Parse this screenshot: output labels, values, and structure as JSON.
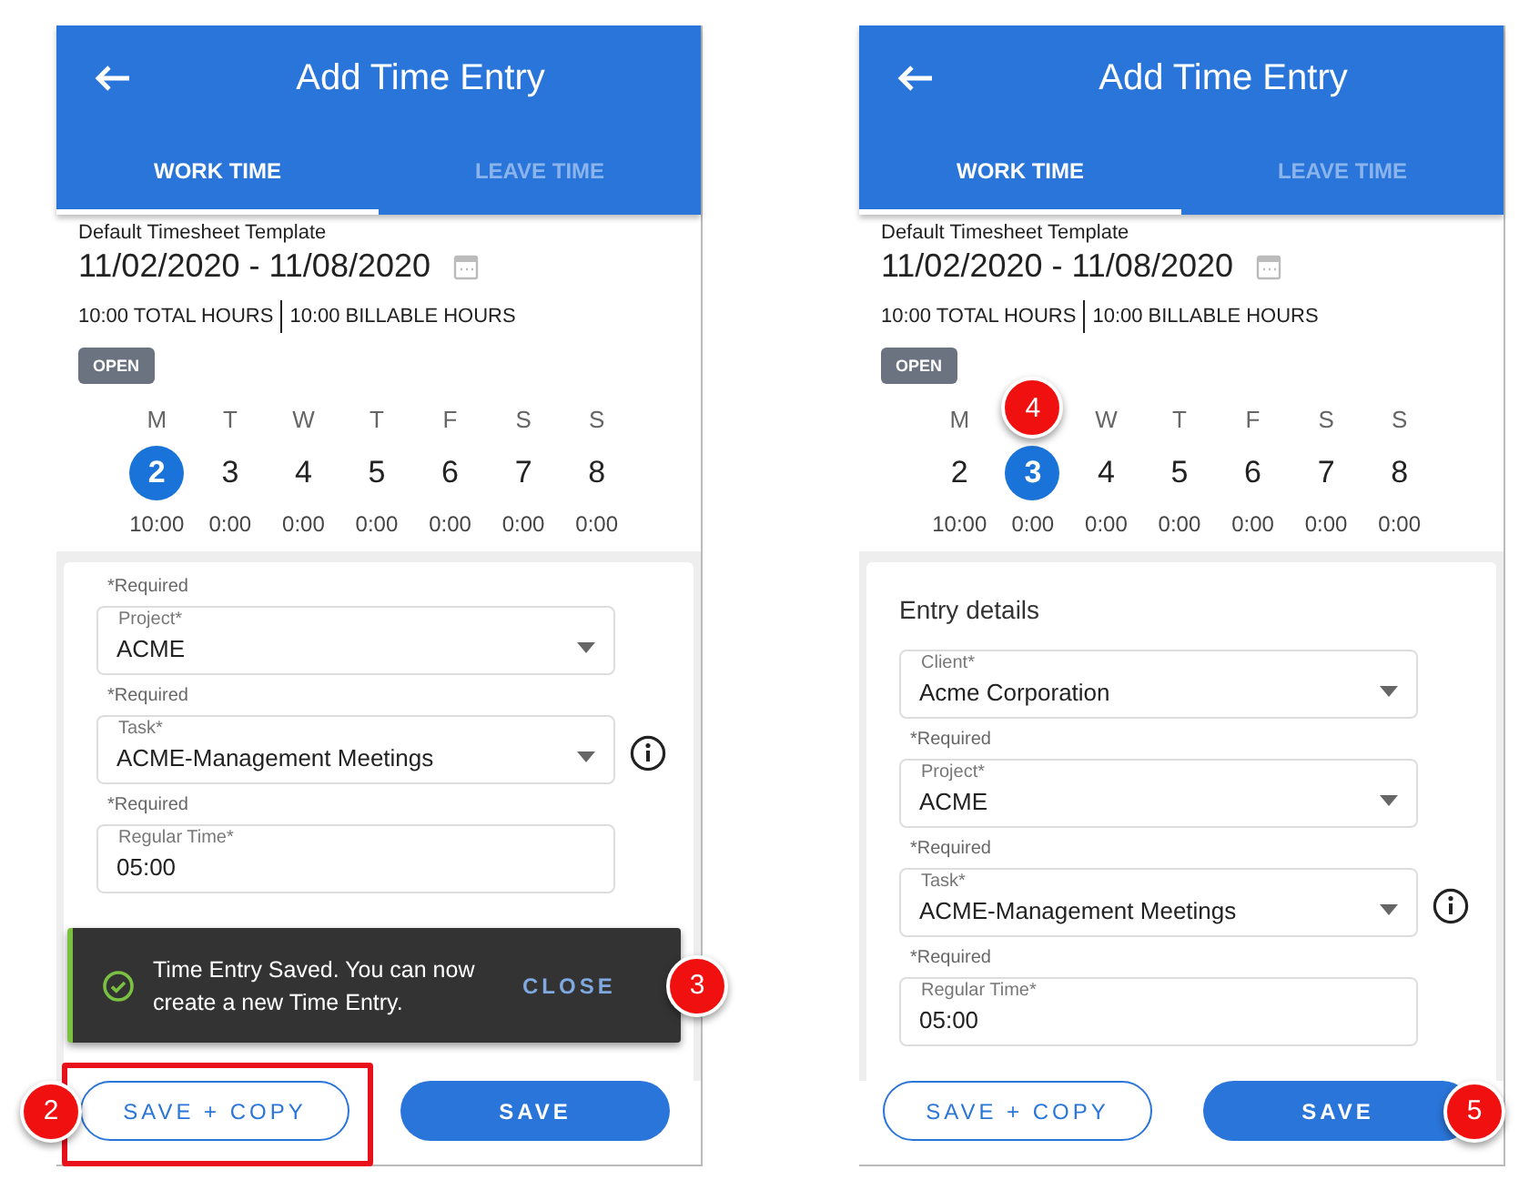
{
  "screens": [
    {
      "title": "Add Time Entry",
      "tabs": [
        {
          "label": "WORK TIME",
          "selected": true
        },
        {
          "label": "LEAVE TIME",
          "selected": false
        }
      ],
      "template": "Default Timesheet Template",
      "date_range": "11/02/2020 - 11/08/2020",
      "total_hours": "10:00 TOTAL HOURS",
      "billable_hours": "10:00 BILLABLE HOURS",
      "status": "OPEN",
      "days": [
        {
          "weekday": "M",
          "date": "2",
          "hours": "10:00",
          "selected": true
        },
        {
          "weekday": "T",
          "date": "3",
          "hours": "0:00",
          "selected": false
        },
        {
          "weekday": "W",
          "date": "4",
          "hours": "0:00",
          "selected": false
        },
        {
          "weekday": "T",
          "date": "5",
          "hours": "0:00",
          "selected": false
        },
        {
          "weekday": "F",
          "date": "6",
          "hours": "0:00",
          "selected": false
        },
        {
          "weekday": "S",
          "date": "7",
          "hours": "0:00",
          "selected": false
        },
        {
          "weekday": "S",
          "date": "8",
          "hours": "0:00",
          "selected": false
        }
      ],
      "card": {
        "fields": [
          {
            "kind": "select",
            "note": "*Required",
            "label": "Project*",
            "value": "ACME",
            "info": false
          },
          {
            "kind": "select",
            "note": "*Required",
            "label": "Task*",
            "value": "ACME-Management Meetings",
            "info": true
          },
          {
            "kind": "text",
            "note": "*Required",
            "label": "Regular Time*",
            "value": "05:00",
            "info": false
          }
        ]
      },
      "toast": {
        "message": "Time Entry Saved. You can now create a new Time Entry.",
        "action": "CLOSE",
        "callout": {
          "number": "3"
        }
      },
      "buttons": [
        {
          "kind": "outline",
          "label": "SAVE + COPY",
          "highlighted": true,
          "callout": {
            "number": "2"
          }
        },
        {
          "kind": "filled",
          "label": "SAVE",
          "highlighted": false
        }
      ]
    },
    {
      "title": "Add Time Entry",
      "tabs": [
        {
          "label": "WORK TIME",
          "selected": true
        },
        {
          "label": "LEAVE TIME",
          "selected": false
        }
      ],
      "template": "Default Timesheet Template",
      "date_range": "11/02/2020 - 11/08/2020",
      "total_hours": "10:00 TOTAL HOURS",
      "billable_hours": "10:00 BILLABLE HOURS",
      "status": "OPEN",
      "days": [
        {
          "weekday": "M",
          "date": "2",
          "hours": "10:00",
          "selected": false
        },
        {
          "date": "3",
          "hours": "0:00",
          "selected": true,
          "callout": {
            "number": "4"
          }
        },
        {
          "weekday": "W",
          "date": "4",
          "hours": "0:00",
          "selected": false
        },
        {
          "weekday": "T",
          "date": "5",
          "hours": "0:00",
          "selected": false
        },
        {
          "weekday": "F",
          "date": "6",
          "hours": "0:00",
          "selected": false
        },
        {
          "weekday": "S",
          "date": "7",
          "hours": "0:00",
          "selected": false
        },
        {
          "weekday": "S",
          "date": "8",
          "hours": "0:00",
          "selected": false
        }
      ],
      "card": {
        "heading": "Entry details",
        "fields": [
          {
            "kind": "select",
            "label": "Client*",
            "value": "Acme Corporation",
            "info": false
          },
          {
            "kind": "select",
            "note": "*Required",
            "label": "Project*",
            "value": "ACME",
            "info": false
          },
          {
            "kind": "select",
            "note": "*Required",
            "label": "Task*",
            "value": "ACME-Management Meetings",
            "info": true
          },
          {
            "kind": "text",
            "note": "*Required",
            "label": "Regular Time*",
            "value": "05:00",
            "info": false
          }
        ]
      },
      "buttons": [
        {
          "kind": "outline",
          "label": "SAVE + COPY",
          "highlighted": false
        },
        {
          "kind": "filled",
          "label": "SAVE",
          "highlighted": false,
          "callout": {
            "number": "5"
          }
        }
      ]
    }
  ]
}
